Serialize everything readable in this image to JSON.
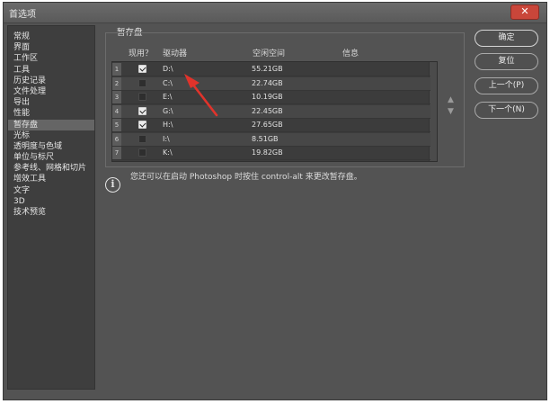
{
  "window": {
    "title": "首选项",
    "close_label": "✕"
  },
  "sidebar": {
    "items": [
      {
        "label": "常规"
      },
      {
        "label": "界面"
      },
      {
        "label": "工作区"
      },
      {
        "label": "工具"
      },
      {
        "label": "历史记录"
      },
      {
        "label": "文件处理"
      },
      {
        "label": "导出"
      },
      {
        "label": "性能"
      },
      {
        "label": "暂存盘",
        "active": true
      },
      {
        "label": "光标"
      },
      {
        "label": "透明度与色域"
      },
      {
        "label": "单位与标尺"
      },
      {
        "label": "参考线、网格和切片"
      },
      {
        "label": "增效工具"
      },
      {
        "label": "文字"
      },
      {
        "label": "3D"
      },
      {
        "label": "技术预览"
      }
    ]
  },
  "scratch": {
    "section_title": "暂存盘",
    "columns": {
      "active": "现用？",
      "drive": "驱动器",
      "free_space": "空闲空间",
      "info": "信息"
    },
    "rows": [
      {
        "num": "1",
        "checked": true,
        "drive": "D:\\",
        "space": "55.21GB"
      },
      {
        "num": "2",
        "checked": false,
        "drive": "C:\\",
        "space": "22.74GB"
      },
      {
        "num": "3",
        "checked": false,
        "drive": "E:\\",
        "space": "10.19GB"
      },
      {
        "num": "4",
        "checked": true,
        "drive": "G:\\",
        "space": "22.45GB"
      },
      {
        "num": "5",
        "checked": true,
        "drive": "H:\\",
        "space": "27.65GB"
      },
      {
        "num": "6",
        "checked": false,
        "drive": "I:\\",
        "space": "8.51GB"
      },
      {
        "num": "7",
        "checked": false,
        "drive": "K:\\",
        "space": "19.82GB"
      }
    ],
    "move_up": "▲",
    "move_down": "▼",
    "info_icon": "i",
    "note": "您还可以在启动 Photoshop 时按住 control-alt 来更改暂存盘。"
  },
  "buttons": {
    "ok": "确定",
    "reset": "复位",
    "prev": "上一个(P)",
    "next": "下一个(N)"
  },
  "colors": {
    "annotation_arrow": "#e0332b"
  }
}
